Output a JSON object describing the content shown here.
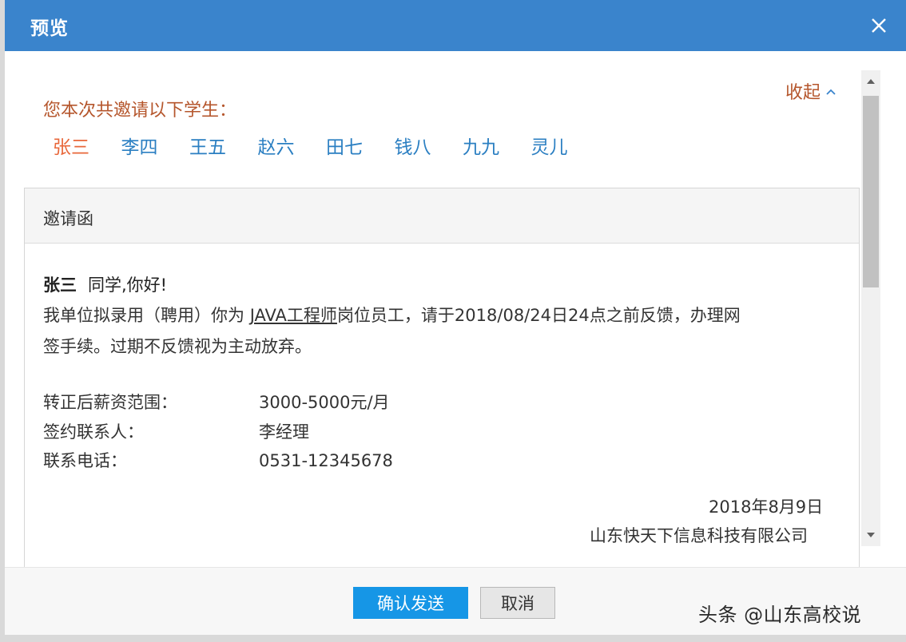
{
  "dialog": {
    "title": "预览",
    "close_icon": "close-icon"
  },
  "intro": {
    "text": "您本次共邀请以下学生：",
    "collapse_label": "收起"
  },
  "students": [
    "张三",
    "李四",
    "王五",
    "赵六",
    "田七",
    "钱八",
    "九九",
    "灵儿"
  ],
  "letter": {
    "header": "邀请函",
    "name": "张三",
    "greeting": "同学,你好!",
    "p1_before": "我单位拟录用（聘用）你为 ",
    "job": "JAVA工程师",
    "p1_after": "岗位员工，请于2018/08/24日24点之前反馈，办理网",
    "p2": "签手续。过期不反馈视为主动放弃。",
    "salary_label": "转正后薪资范围：",
    "salary_value": "3000-5000元/月",
    "contact_label": "签约联系人：",
    "contact_value": "李经理",
    "phone_label": "联系电话：",
    "phone_value": "0531-12345678",
    "date": "2018年8月9日",
    "company": "山东快天下信息科技有限公司"
  },
  "footer": {
    "confirm_label": "确认发送",
    "cancel_label": "取消"
  },
  "watermark": "头条 @山东高校说",
  "colors": {
    "title_bar": "#3a84cc",
    "accent_orange": "#b5562c",
    "active_name": "#e8673a",
    "name_link": "#2b7fc2",
    "confirm_button": "#1696e6"
  }
}
